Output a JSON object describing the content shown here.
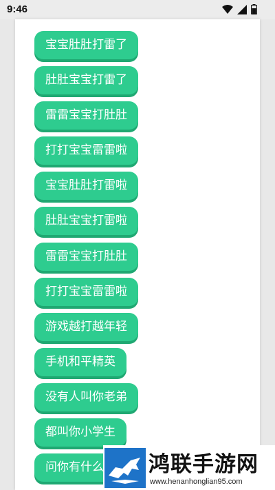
{
  "status_bar": {
    "time": "9:46"
  },
  "buttons": [
    "宝宝肚肚打雷了",
    "肚肚宝宝打雷了",
    "雷雷宝宝打肚肚",
    "打打宝宝雷雷啦",
    "宝宝肚肚打雷啦",
    "肚肚宝宝打雷啦",
    "雷雷宝宝打肚肚",
    "打打宝宝雷雷啦",
    "游戏越打越年轻",
    "手机和平精英",
    "没有人叫你老弟",
    "都叫你小学生",
    "问你有什么"
  ],
  "watermark": {
    "title": "鸿联手游网",
    "url": "www.henanhonglian95.com"
  },
  "colors": {
    "button": "#2ecc8f",
    "button_shadow": "#1fa872",
    "logo_blue": "#1e73c8"
  }
}
